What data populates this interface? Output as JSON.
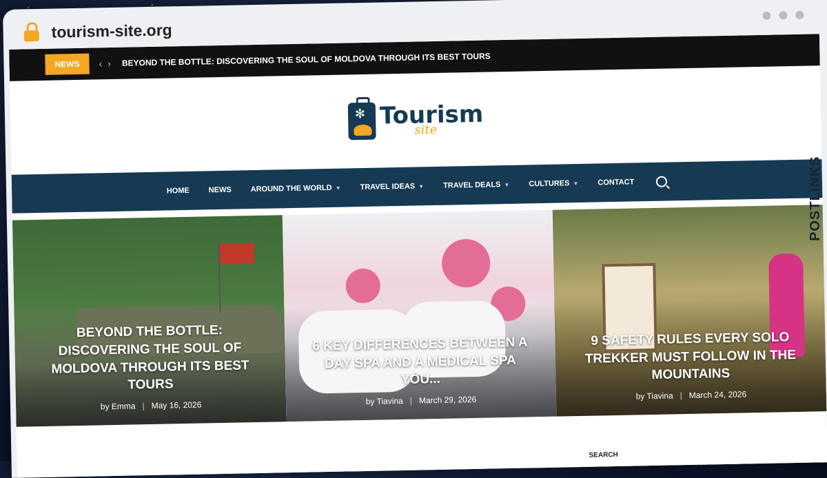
{
  "browser": {
    "url": "tourism-site.org"
  },
  "ticker": {
    "tag": "NEWS",
    "headline": "BEYOND THE BOTTLE: DISCOVERING THE SOUL OF MOLDOVA THROUGH ITS BEST TOURS"
  },
  "logo": {
    "main": "Tourism",
    "sub": "site"
  },
  "nav": {
    "items": [
      {
        "label": "HOME",
        "dropdown": false
      },
      {
        "label": "NEWS",
        "dropdown": false
      },
      {
        "label": "AROUND THE WORLD",
        "dropdown": true
      },
      {
        "label": "TRAVEL IDEAS",
        "dropdown": true
      },
      {
        "label": "TRAVEL DEALS",
        "dropdown": true
      },
      {
        "label": "CULTURES",
        "dropdown": true
      },
      {
        "label": "CONTACT",
        "dropdown": false
      }
    ]
  },
  "cards": [
    {
      "title": "BEYOND THE BOTTLE: DISCOVERING THE SOUL OF MOLDOVA THROUGH ITS BEST TOURS",
      "author": "by Emma",
      "date": "May 16, 2026"
    },
    {
      "title": "6 KEY DIFFERENCES BETWEEN A DAY SPA AND A MEDICAL SPA YOU...",
      "author": "by Tiavina",
      "date": "March 29, 2026"
    },
    {
      "title": "9 SAFETY RULES EVERY SOLO TREKKER MUST FOLLOW IN THE MOUNTAINS",
      "author": "by Tiavina",
      "date": "March 24, 2026"
    }
  ],
  "sidebar": {
    "search_label": "SEARCH"
  },
  "watermark": "POSTLINKS",
  "colors": {
    "accent": "#f5a623",
    "nav_bg": "#163a53",
    "ticker_bg": "#111111"
  }
}
